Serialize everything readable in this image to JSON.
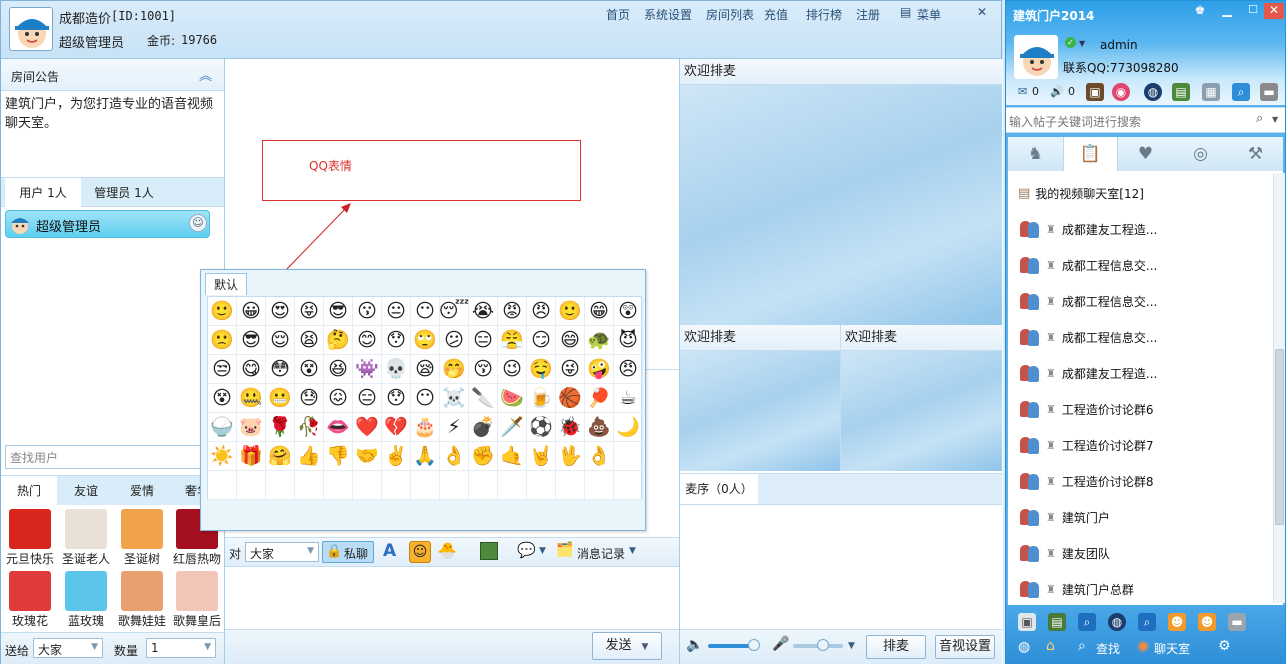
{
  "header": {
    "room_name": "成都造价",
    "room_id": "[ID:1001]",
    "user_name": "超级管理员",
    "coins_label": "金币:",
    "coins_value": "19766",
    "nav": [
      "首页",
      "系统设置",
      "房间列表",
      "充值",
      "排行榜",
      "注册"
    ],
    "menu_label": "菜单"
  },
  "announcement": {
    "title": "房间公告",
    "text": "建筑门户，为您打造专业的语音视频聊天室。"
  },
  "users_tabs": [
    "用户 1人",
    "管理员 1人"
  ],
  "users": [
    {
      "name": "超级管理员"
    }
  ],
  "search_user_placeholder": "查找用户",
  "gift_tabs": [
    "热门",
    "友谊",
    "爱情",
    "奢华"
  ],
  "gifts": [
    {
      "label": "元旦快乐",
      "color": "#d8261c"
    },
    {
      "label": "圣诞老人",
      "color": "#e9e1d7"
    },
    {
      "label": "圣诞树",
      "color": "#f0a34a"
    },
    {
      "label": "红唇热吻",
      "color": "#a4101e"
    },
    {
      "label": "玫瑰花",
      "color": "#e03a3a"
    },
    {
      "label": "蓝玫瑰",
      "color": "#5cc6ea"
    },
    {
      "label": "歌舞娃娃",
      "color": "#e8a070"
    },
    {
      "label": "歌舞皇后",
      "color": "#f2c6b8"
    }
  ],
  "gift_bar": {
    "send_to_label": "送给",
    "send_to_value": "大家",
    "quantity_label": "数量",
    "quantity_value": "1"
  },
  "annotation": {
    "label": "QQ表情"
  },
  "emoji_panel": {
    "tab": "默认",
    "emojis": [
      "🙂",
      "😀",
      "😍",
      "😝",
      "😎",
      "😗",
      "😐",
      "😶",
      "😴",
      "😭",
      "😡",
      "😠",
      "🙂",
      "😁",
      "😲",
      "🙁",
      "😎",
      "😌",
      "😫",
      "🤔",
      "😊",
      "😯",
      "🙄",
      "😕",
      "😑",
      "😤",
      "😏",
      "😄",
      "🐢",
      "😈",
      "😒",
      "😋",
      "😳",
      "😵",
      "😆",
      "👾",
      "💀",
      "😪",
      "🤭",
      "😚",
      "😉",
      "🤤",
      "😜",
      "🤪",
      "😠",
      "😵",
      "🤐",
      "😬",
      "😓",
      "😖",
      "😑",
      "😯",
      "😶",
      "☠️",
      "🔪",
      "🍉",
      "🍺",
      "🏀",
      "🏓",
      "☕",
      "🍚",
      "🐷",
      "🌹",
      "🥀",
      "👄",
      "❤️",
      "💔",
      "🎂",
      "⚡",
      "💣",
      "🗡️",
      "⚽",
      "🐞",
      "💩",
      "🌙",
      "☀️",
      "🎁",
      "🤗",
      "👍",
      "👎",
      "🤝",
      "✌️",
      "🙏",
      "👌",
      "✊",
      "🤙",
      "🤘",
      "🖖",
      "👌"
    ]
  },
  "chat_toolbar": {
    "to_label": "对",
    "to_value": "大家",
    "private_label": "私聊",
    "history_label": "消息记录"
  },
  "send_button": "发送",
  "video": {
    "main_title": "欢迎排麦",
    "sub_left_title": "欢迎排麦",
    "sub_right_title": "欢迎排麦",
    "queue_tab": "麦序（0人）",
    "queue_button": "排麦",
    "settings_button": "音视设置"
  },
  "sidebar": {
    "app_title": "建筑门户2014",
    "username": "admin",
    "contact": "联系QQ:773098280",
    "mail_count": "0",
    "msg_count": "0",
    "search_placeholder": "输入帖子关键词进行搜索",
    "list_header": "我的视频聊天室[12]",
    "rooms": [
      "成都建友工程造...",
      "成都工程信息交...",
      "成都工程信息交...",
      "成都工程信息交...",
      "成都建友工程造...",
      "工程造价讨论群6",
      "工程造价讨论群7",
      "工程造价讨论群8",
      "建筑门户",
      "建友团队",
      "建筑门户总群"
    ],
    "find_label": "查找",
    "chatroom_label": "聊天室"
  }
}
